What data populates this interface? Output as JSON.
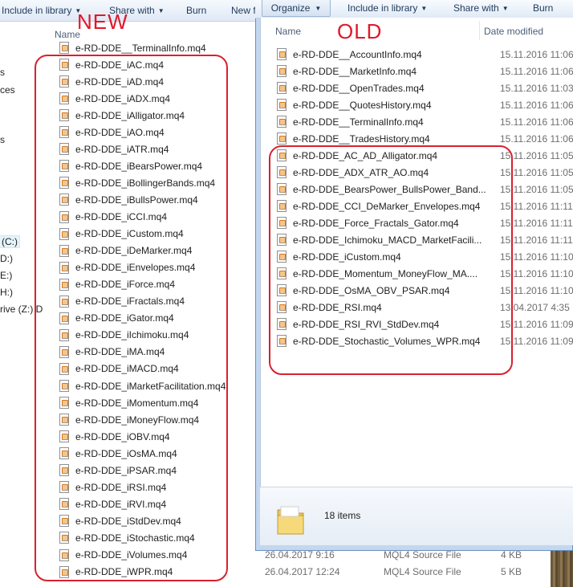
{
  "back_window": {
    "toolbar": {
      "include_label": "Include in library",
      "share_label": "Share with",
      "burn_label": "Burn",
      "new_folder_label": "New f"
    },
    "nav_fragments": [
      "s",
      "ces",
      "s",
      "(C:)",
      "D:)",
      "E:)",
      "H:)",
      "rive (Z:) D"
    ],
    "column_name": "Name",
    "annotation": "NEW",
    "files": [
      "e-RD-DDE__TerminalInfo.mq4",
      "e-RD-DDE_iAC.mq4",
      "e-RD-DDE_iAD.mq4",
      "e-RD-DDE_iADX.mq4",
      "e-RD-DDE_iAlligator.mq4",
      "e-RD-DDE_iAO.mq4",
      "e-RD-DDE_iATR.mq4",
      "e-RD-DDE_iBearsPower.mq4",
      "e-RD-DDE_iBollingerBands.mq4",
      "e-RD-DDE_iBullsPower.mq4",
      "e-RD-DDE_iCCI.mq4",
      "e-RD-DDE_iCustom.mq4",
      "e-RD-DDE_iDeMarker.mq4",
      "e-RD-DDE_iEnvelopes.mq4",
      "e-RD-DDE_iForce.mq4",
      "e-RD-DDE_iFractals.mq4",
      "e-RD-DDE_iGator.mq4",
      "e-RD-DDE_iIchimoku.mq4",
      "e-RD-DDE_iMA.mq4",
      "e-RD-DDE_iMACD.mq4",
      "e-RD-DDE_iMarketFacilitation.mq4",
      "e-RD-DDE_iMomentum.mq4",
      "e-RD-DDE_iMoneyFlow.mq4",
      "e-RD-DDE_iOBV.mq4",
      "e-RD-DDE_iOsMA.mq4",
      "e-RD-DDE_iPSAR.mq4",
      "e-RD-DDE_iRSI.mq4",
      "e-RD-DDE_iRVI.mq4",
      "e-RD-DDE_iStdDev.mq4",
      "e-RD-DDE_iStochastic.mq4",
      "e-RD-DDE_iVolumes.mq4",
      "e-RD-DDE_iWPR.mq4"
    ],
    "status_rows": [
      {
        "date": "26.04.2017 9:16",
        "type": "MQL4 Source File",
        "size": "4 KB"
      },
      {
        "date": "26.04.2017 12:24",
        "type": "MQL4 Source File",
        "size": "5 KB"
      }
    ]
  },
  "front_window": {
    "toolbar": {
      "organize_label": "Organize",
      "include_label": "Include in library",
      "share_label": "Share with",
      "burn_label": "Burn"
    },
    "columns": {
      "name": "Name",
      "date": "Date modified"
    },
    "annotation": "OLD",
    "files": [
      {
        "name": "e-RD-DDE__AccountInfo.mq4",
        "date": "15.11.2016 11:06"
      },
      {
        "name": "e-RD-DDE__MarketInfo.mq4",
        "date": "15.11.2016 11:06"
      },
      {
        "name": "e-RD-DDE__OpenTrades.mq4",
        "date": "15.11.2016 11:03"
      },
      {
        "name": "e-RD-DDE__QuotesHistory.mq4",
        "date": "15.11.2016 11:06"
      },
      {
        "name": "e-RD-DDE__TerminalInfo.mq4",
        "date": "15.11.2016 11:06"
      },
      {
        "name": "e-RD-DDE__TradesHistory.mq4",
        "date": "15.11.2016 11:06"
      },
      {
        "name": "e-RD-DDE_AC_AD_Alligator.mq4",
        "date": "15.11.2016 11:05"
      },
      {
        "name": "e-RD-DDE_ADX_ATR_AO.mq4",
        "date": "15.11.2016 11:05"
      },
      {
        "name": "e-RD-DDE_BearsPower_BullsPower_Band...",
        "date": "15.11.2016 11:05"
      },
      {
        "name": "e-RD-DDE_CCI_DeMarker_Envelopes.mq4",
        "date": "15.11.2016 11:11"
      },
      {
        "name": "e-RD-DDE_Force_Fractals_Gator.mq4",
        "date": "15.11.2016 11:11"
      },
      {
        "name": "e-RD-DDE_Ichimoku_MACD_MarketFacili...",
        "date": "15.11.2016 11:11"
      },
      {
        "name": "e-RD-DDE_iCustom.mq4",
        "date": "15.11.2016 11:10"
      },
      {
        "name": "e-RD-DDE_Momentum_MoneyFlow_MA....",
        "date": "15.11.2016 11:10"
      },
      {
        "name": "e-RD-DDE_OsMA_OBV_PSAR.mq4",
        "date": "15.11.2016 11:10"
      },
      {
        "name": "e-RD-DDE_RSI.mq4",
        "date": "13.04.2017 4:35"
      },
      {
        "name": "e-RD-DDE_RSI_RVI_StdDev.mq4",
        "date": "15.11.2016 11:09"
      },
      {
        "name": "e-RD-DDE_Stochastic_Volumes_WPR.mq4",
        "date": "15.11.2016 11:09"
      }
    ],
    "details": {
      "item_count": "18 items"
    }
  },
  "colors": {
    "annotation_red": "#d8212f",
    "toolbar_text": "#1e395b",
    "header_text": "#4c607a"
  },
  "icons": {
    "file": "mq4-file-icon",
    "folder": "folder-icon",
    "dropdown": "chevron-down-icon"
  }
}
